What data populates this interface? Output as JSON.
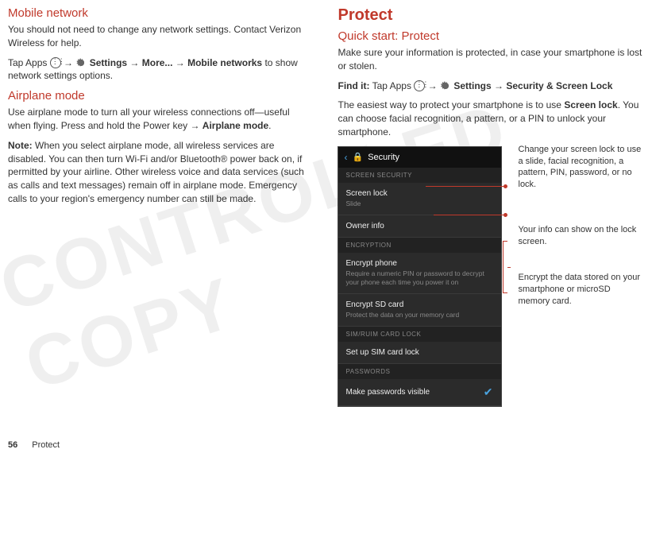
{
  "left": {
    "h_mobile": "Mobile network",
    "p_mobile": "You should not need to change any network settings. Contact Verizon Wireless for help.",
    "p_tap_pre": "Tap Apps ",
    "p_tap_mid1": " → ",
    "p_tap_settings": "Settings",
    "p_tap_mid2": " → ",
    "p_tap_more": "More...",
    "p_tap_mid3": " → ",
    "p_tap_mn": "Mobile networks",
    "p_tap_post": " to show network settings options.",
    "h_airplane": "Airplane mode",
    "p_airplane1a": "Use airplane mode to turn all your wireless connections off—useful when flying. Press and hold the Power key → ",
    "p_airplane1b": "Airplane mode",
    "p_airplane1c": ".",
    "p_note_label": "Note:",
    "p_note": " When you select airplane mode, all wireless services are disabled. You can then turn Wi-Fi and/or Bluetooth® power back on, if permitted by your airline. Other wireless voice and data services (such as calls and text messages) remain off in airplane mode. Emergency calls to your region's emergency number can still be made."
  },
  "right": {
    "h_protect": "Protect",
    "h_quick": "Quick start: Protect",
    "p_intro": "Make sure your information is protected, in case your smartphone is lost or stolen.",
    "find_label": "Find it:",
    "find_pre": " Tap Apps ",
    "find_mid1": " → ",
    "find_settings": "Settings",
    "find_mid2": " → ",
    "find_sec": "Security & Screen Lock",
    "p_easy_a": "The easiest way to protect your smartphone is to use ",
    "p_easy_b": "Screen lock",
    "p_easy_c": ". You can choose facial recognition, a pattern, or a PIN to unlock your smartphone."
  },
  "phone": {
    "title": "Security",
    "cat1": "SCREEN SECURITY",
    "r1": "Screen lock",
    "r1s": "Slide",
    "r2": "Owner info",
    "cat2": "ENCRYPTION",
    "r3": "Encrypt phone",
    "r3s": "Require a numeric PIN or password to decrypt your phone each time you power it on",
    "r4": "Encrypt SD card",
    "r4s": "Protect the data on your memory card",
    "cat3": "SIM/RUIM CARD LOCK",
    "r5": "Set up SIM card lock",
    "cat4": "PASSWORDS",
    "r6": "Make passwords visible"
  },
  "callouts": {
    "c1": "Change your screen lock to use a slide, facial recognition, a pattern, PIN, password, or no lock.",
    "c2": "Your info can show on the lock screen.",
    "c3": "Encrypt the data stored on your smartphone or microSD memory card."
  },
  "footer": {
    "num": "56",
    "name": "Protect"
  },
  "wm": "CONTROLLED COPY"
}
